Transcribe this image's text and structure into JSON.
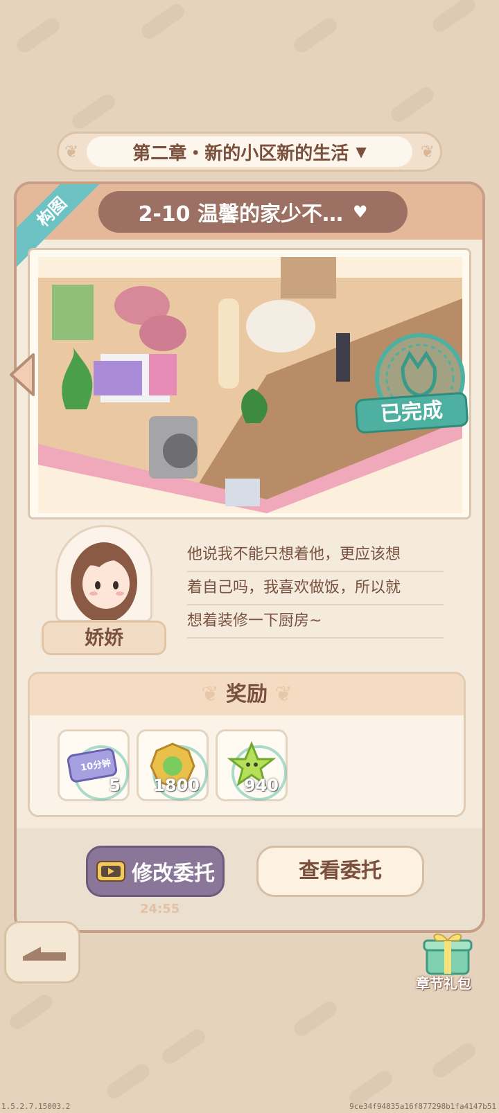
{
  "chapter": {
    "title": "第二章・新的小区新的生活"
  },
  "level": {
    "title": "2-10 温馨的家少不…",
    "ribbon": "构图"
  },
  "preview": {
    "status": "已完成"
  },
  "character": {
    "name": "娇娇",
    "dialog": [
      "他说我不能只想着他，更应该想",
      "着自己吗，我喜欢做饭，所以就",
      "想着装修一下厨房~"
    ]
  },
  "rewards": {
    "title": "奖励",
    "items": [
      {
        "icon": "time-ticket-icon",
        "badge": "10分钟",
        "count": "5"
      },
      {
        "icon": "gold-coin-icon",
        "count": "1800"
      },
      {
        "icon": "star-icon",
        "count": "940"
      }
    ]
  },
  "buttons": {
    "modify": "修改委托",
    "view": "查看委托",
    "timer": "24:55"
  },
  "gift": {
    "label": "章节礼包"
  },
  "footer": {
    "version": "1.5.2.7.15003.2",
    "hash": "9ce34f94835a16f877298b1fa4147b51"
  },
  "colors": {
    "accent": "#6cc2c3",
    "complete": "#4eb0a0",
    "brown": "#7a4f3c"
  }
}
